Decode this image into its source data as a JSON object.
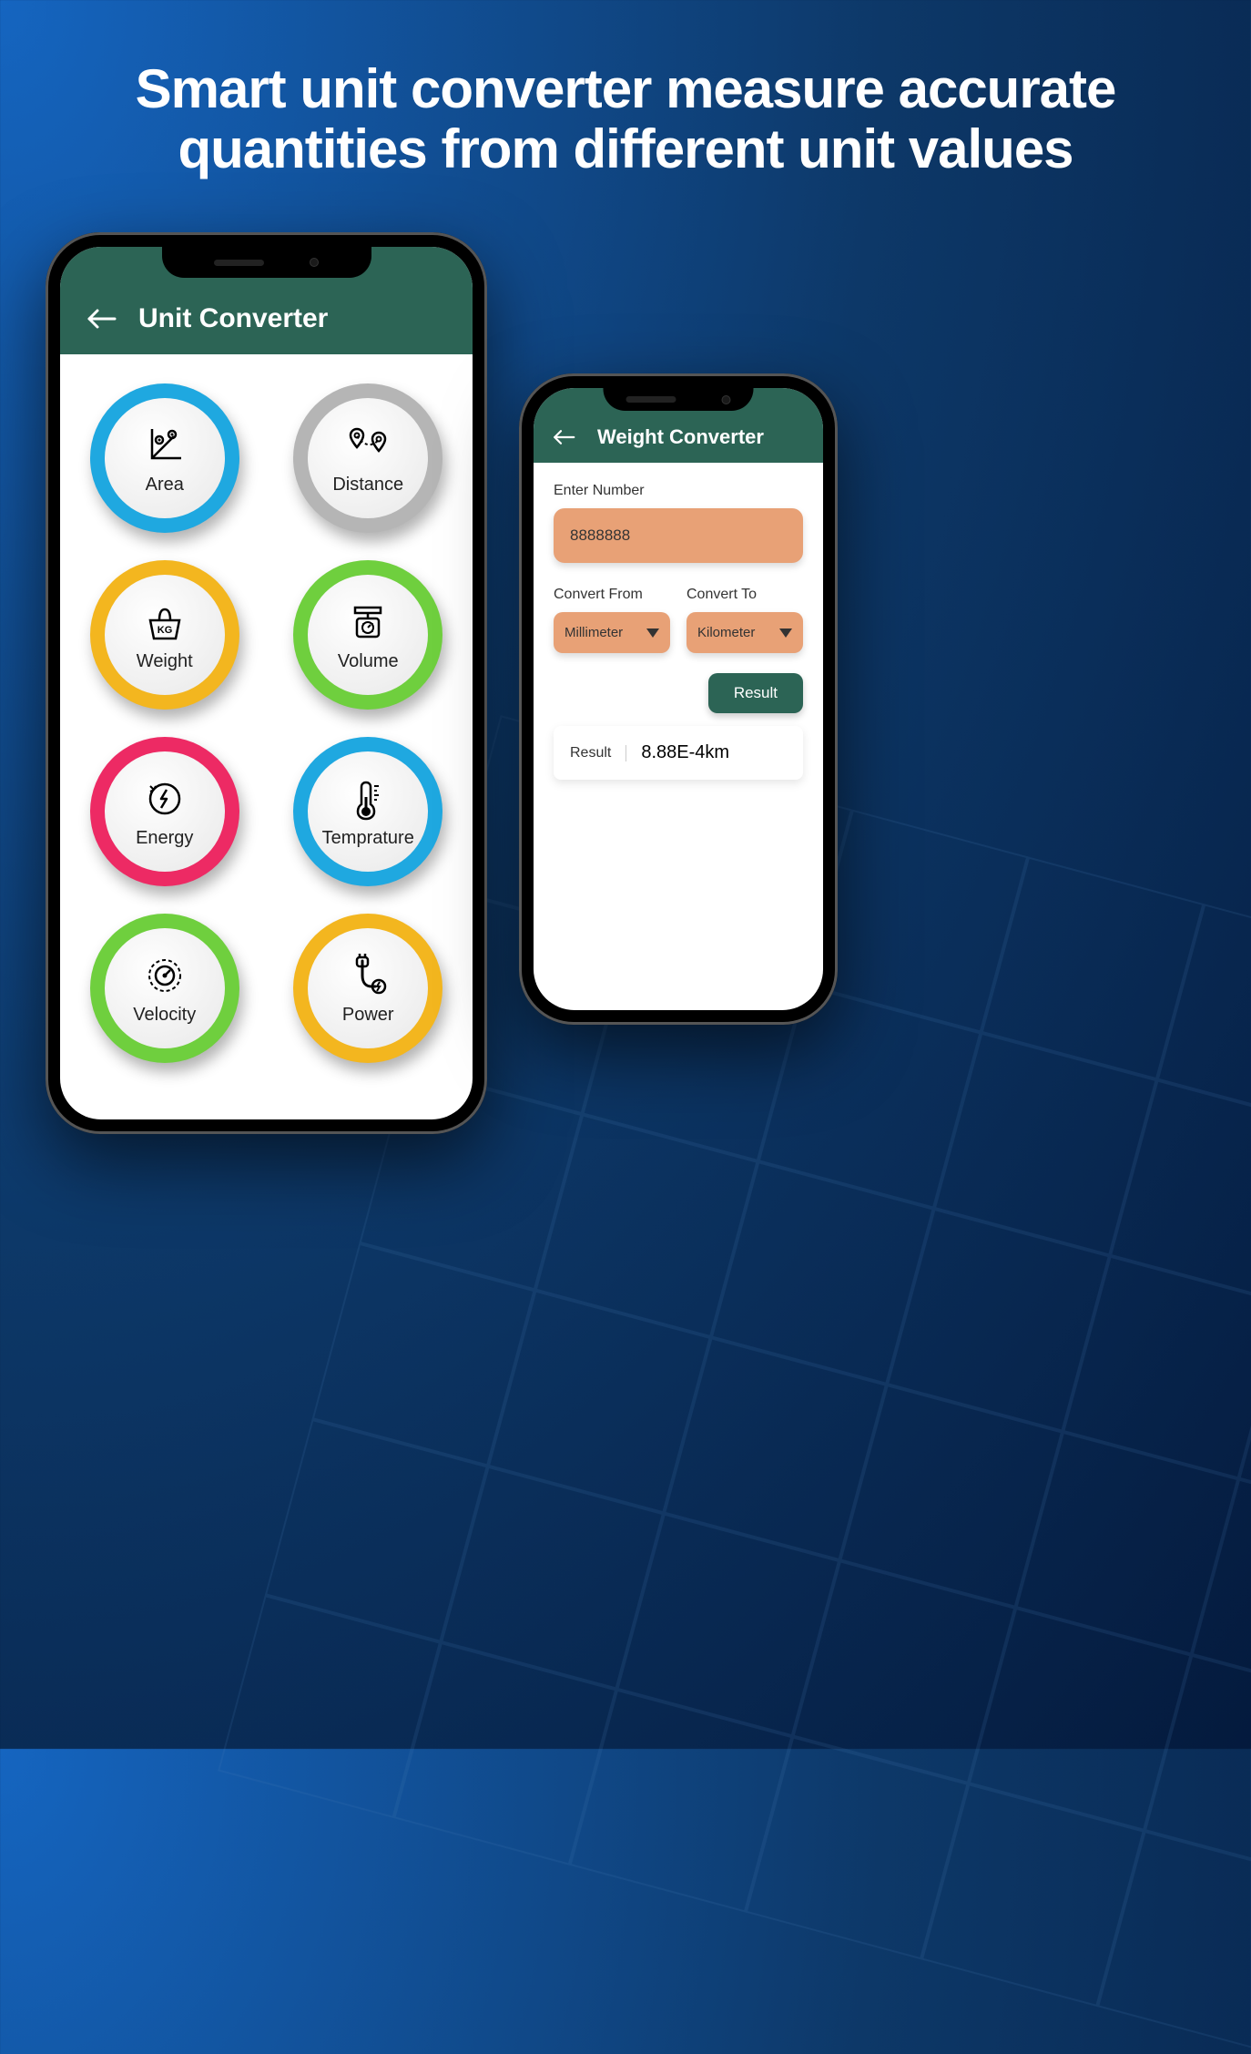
{
  "marketing": {
    "headline": "Smart unit converter measure accurate quantities from different unit values"
  },
  "mainScreen": {
    "title": "Unit Converter",
    "categories": [
      {
        "label": "Area",
        "color": "#1fa8e0"
      },
      {
        "label": "Distance",
        "color": "#b5b5b5"
      },
      {
        "label": "Weight",
        "color": "#f3b61f"
      },
      {
        "label": "Volume",
        "color": "#6fcf3e"
      },
      {
        "label": "Energy",
        "color": "#ed2a64"
      },
      {
        "label": "Temprature",
        "color": "#1fa8e0"
      },
      {
        "label": "Velocity",
        "color": "#6fcf3e"
      },
      {
        "label": "Power",
        "color": "#f3b61f"
      }
    ]
  },
  "converterScreen": {
    "title": "Weight Converter",
    "enterLabel": "Enter Number",
    "inputValue": "8888888",
    "fromLabel": "Convert From",
    "toLabel": "Convert To",
    "fromValue": "Millimeter",
    "toValue": "Kilometer",
    "resultButton": "Result",
    "resultLabel": "Result",
    "resultValue": "8.88E-4km"
  }
}
